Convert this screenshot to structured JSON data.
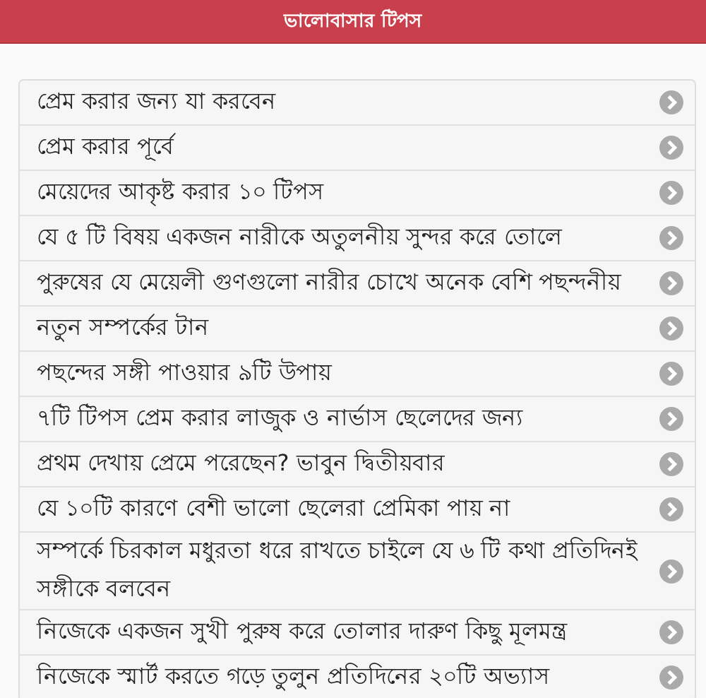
{
  "header": {
    "title": "ভালোবাসার টিপস"
  },
  "items": [
    {
      "label": "প্রেম করার জন্য যা করবেন"
    },
    {
      "label": "প্রেম করার পূর্বে"
    },
    {
      "label": "মেয়েদের আকৃষ্ট করার ১০ টিপস"
    },
    {
      "label": "যে ৫ টি বিষয় একজন নারীকে অতুলনীয় সুন্দর করে তোলে"
    },
    {
      "label": "পুরুষের যে মেয়েলী গুণগুলো নারীর চোখে অনেক বেশি পছন্দনীয়"
    },
    {
      "label": "নতুন সম্পর্কের টান"
    },
    {
      "label": "পছন্দের সঙ্গী পাওয়ার ৯টি উপায়"
    },
    {
      "label": "৭টি টিপস প্রেম করার লাজুক ও নার্ভাস ছেলেদের জন্য"
    },
    {
      "label": "প্রথম দেখায় প্রেমে পরেছেন? ভাবুন দ্বিতীয়বার"
    },
    {
      "label": "যে ১০টি কারণে বেশী ভালো ছেলেরা প্রেমিকা পায় না"
    },
    {
      "label": "সম্পর্কে চিরকাল মধুরতা ধরে রাখতে চাইলে যে ৬ টি কথা প্রতিদিনই সঙ্গীকে বলবেন"
    },
    {
      "label": "নিজেকে একজন সুখী পুরুষ করে তোলার দারুণ কিছু মূলমন্ত্র"
    },
    {
      "label": "নিজেকে স্মার্ট করতে গড়ে তুলুন প্রতিদিনের ২০টি অভ্যাস"
    }
  ]
}
